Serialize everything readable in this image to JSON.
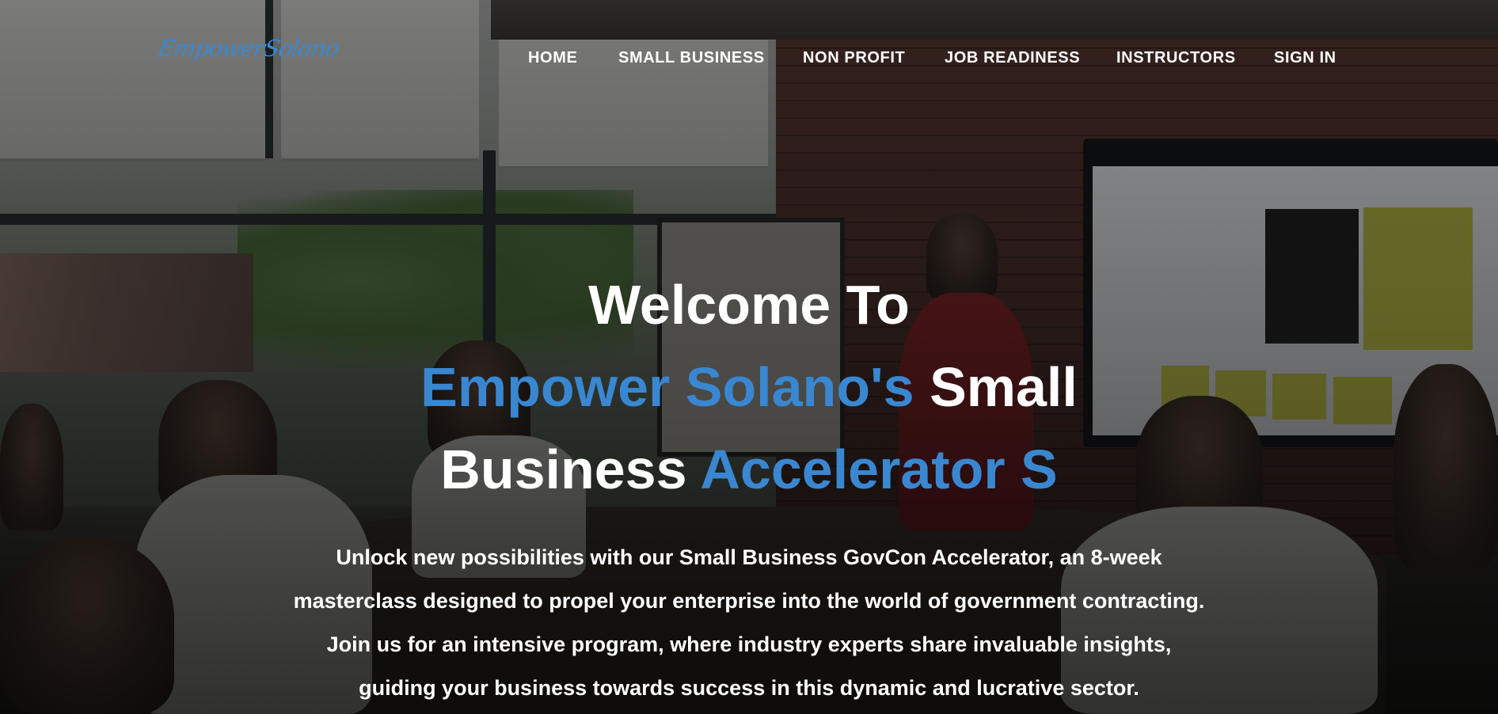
{
  "brand": {
    "logo_text": "EmpowerSolano",
    "accent_color": "#3a87d1"
  },
  "nav": {
    "items": [
      {
        "label": "HOME"
      },
      {
        "label": "SMALL BUSINESS"
      },
      {
        "label": "NON PROFIT"
      },
      {
        "label": "JOB READINESS"
      },
      {
        "label": "INSTRUCTORS"
      },
      {
        "label": "SIGN IN"
      }
    ]
  },
  "hero": {
    "line1": "Welcome To",
    "line2_blue": "Empower Solano's",
    "line2_white": "Small",
    "line3_white": "Business",
    "line3_blue": "Accelerator S",
    "paragraph_lines": [
      "Unlock new possibilities with our Small Business GovCon Accelerator, an 8-week",
      "masterclass designed to propel your enterprise into the world of government contracting.",
      "Join us for an intensive program, where industry experts share invaluable insights,",
      "guiding your business towards success in this dynamic and lucrative sector."
    ]
  }
}
